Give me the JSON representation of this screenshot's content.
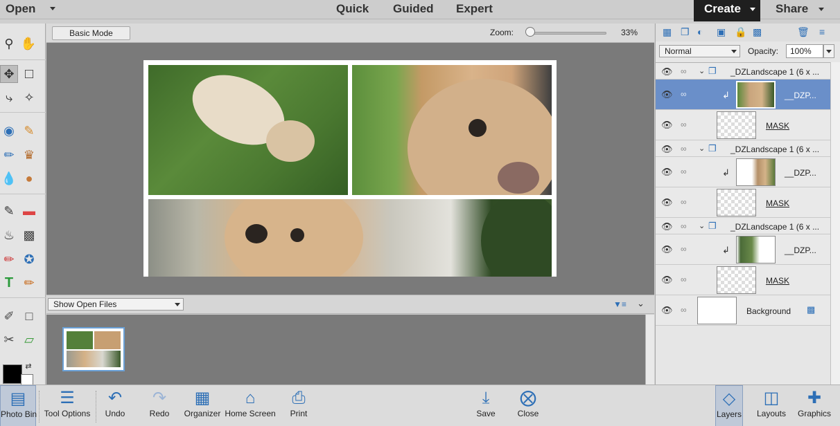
{
  "topbar": {
    "open_label": "Open",
    "modes": [
      "Quick",
      "Guided",
      "Expert"
    ],
    "active_mode": "Expert",
    "create_label": "Create",
    "share_label": "Share"
  },
  "options": {
    "basic_mode_label": "Basic Mode",
    "zoom_label": "Zoom:",
    "zoom_value": "33%",
    "zoom_level_percent": 33
  },
  "bin": {
    "select_value": "Show Open Files"
  },
  "layers": {
    "blend_mode": "Normal",
    "opacity_label": "Opacity:",
    "opacity_value": "100%",
    "rows": [
      {
        "name": "_DZLandscape 1 (6 x ...",
        "type": "group"
      },
      {
        "name": "__DZP...",
        "type": "photo",
        "selected": true
      },
      {
        "name": "MASK",
        "type": "mask"
      },
      {
        "name": "_DZLandscape 1 (6 x ...",
        "type": "group"
      },
      {
        "name": "__DZP...",
        "type": "photo"
      },
      {
        "name": "MASK",
        "type": "mask"
      },
      {
        "name": "_DZLandscape 1 (6 x ...",
        "type": "group"
      },
      {
        "name": "__DZP...",
        "type": "photo"
      },
      {
        "name": "MASK",
        "type": "mask"
      },
      {
        "name": "Background",
        "type": "background"
      }
    ]
  },
  "bottombar": {
    "left": [
      {
        "label": "Photo Bin",
        "icon": "photo-bin-icon"
      },
      {
        "label": "Tool Options",
        "icon": "tool-options-icon"
      },
      {
        "label": "Undo",
        "icon": "undo-icon"
      },
      {
        "label": "Redo",
        "icon": "redo-icon"
      },
      {
        "label": "Organizer",
        "icon": "organizer-icon"
      },
      {
        "label": "Home Screen",
        "icon": "home-icon"
      },
      {
        "label": "Print",
        "icon": "print-icon"
      }
    ],
    "center": [
      {
        "label": "Save",
        "icon": "save-icon"
      },
      {
        "label": "Close",
        "icon": "close-icon"
      }
    ],
    "right": [
      {
        "label": "Layers",
        "icon": "layers-icon"
      },
      {
        "label": "Layouts",
        "icon": "layouts-icon"
      },
      {
        "label": "Graphics",
        "icon": "graphics-icon"
      }
    ]
  },
  "colors": {
    "accent": "#2d6fb6",
    "selected_layer": "#6a8fc9",
    "foreground_color": "#000000",
    "background_color": "#ffffff"
  }
}
